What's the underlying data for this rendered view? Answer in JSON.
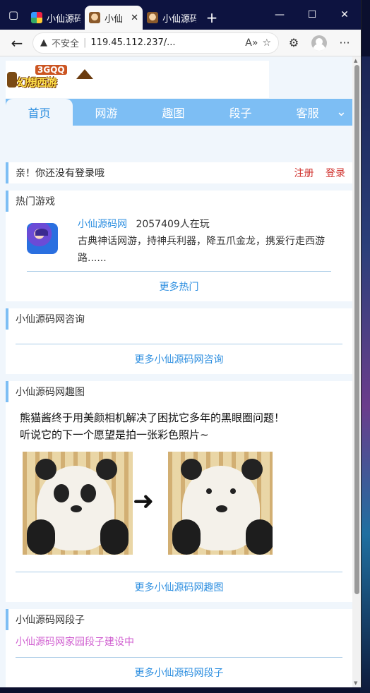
{
  "browser": {
    "tabs": [
      {
        "label": "小仙源码"
      },
      {
        "label": "小仙"
      },
      {
        "label": "小仙源码"
      }
    ],
    "new_tab": "+",
    "insecure_label": "不安全",
    "url": "119.45.112.237/..."
  },
  "site": {
    "logo_small": "3GQQ",
    "logo_main": "幻想西游"
  },
  "nav": {
    "items": [
      "首页",
      "网游",
      "趣图",
      "段子",
      "客服"
    ]
  },
  "login_bar": {
    "message": "亲！你还没有登录哦",
    "register": "注册",
    "login": "登录"
  },
  "hot_games": {
    "title": "热门游戏",
    "game_name": "小仙源码网",
    "players": "2057409人在玩",
    "description": "古典神话网游，持神兵利器，降五爪金龙，携爱行走西游路......",
    "more": "更多热门"
  },
  "news": {
    "title": "小仙源码网咨询",
    "more": "更多小仙源码网咨询"
  },
  "fun_pics": {
    "title": "小仙源码网趣图",
    "caption_line1": "熊猫酱终于用美颜相机解决了困扰它多年的黑眼圈问题！",
    "caption_line2": "听说它的下一个愿望是拍一张彩色照片~",
    "more": "更多小仙源码网趣图"
  },
  "jokes": {
    "title": "小仙源码网段子",
    "message": "小仙源码网家园段子建设中",
    "more": "更多小仙源码网段子"
  },
  "colors": {
    "accent": "#7dbef4",
    "link": "#2e8fe0",
    "alert": "#d0312d",
    "pink": "#d05fd0"
  }
}
